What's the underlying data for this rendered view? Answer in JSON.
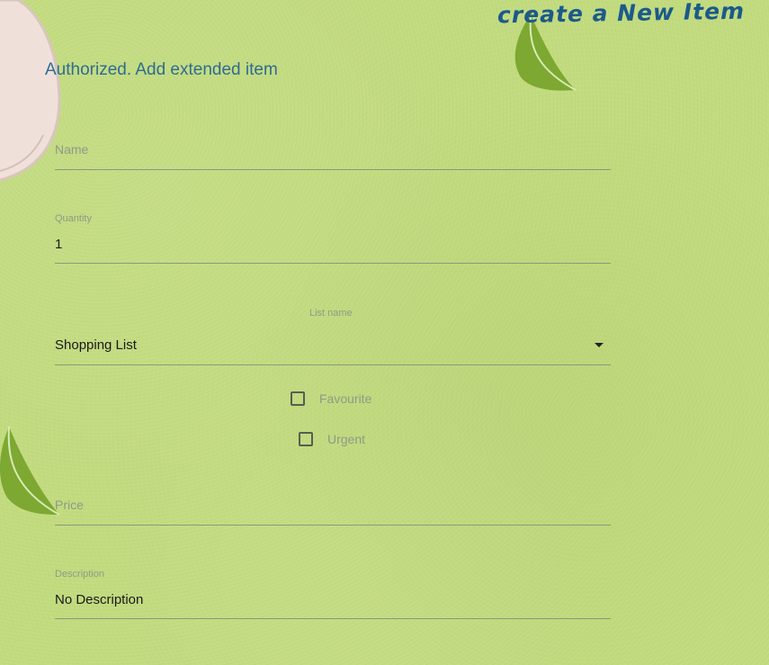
{
  "header": {
    "title": "create a New Item",
    "status": "Authorized. Add extended item"
  },
  "form": {
    "name": {
      "placeholder": "Name",
      "value": ""
    },
    "quantity": {
      "label": "Quantity",
      "value": "1"
    },
    "list": {
      "label": "List name",
      "selected": "Shopping List"
    },
    "favourite": {
      "label": "Favourite",
      "checked": false
    },
    "urgent": {
      "label": "Urgent",
      "checked": false
    },
    "price": {
      "placeholder": "Price",
      "value": ""
    },
    "description": {
      "label": "Description",
      "value": "No Description"
    }
  },
  "icons": {
    "dropdown": "caret-down-icon",
    "decoration_top": "mushroom-decoration",
    "decoration_leaf_top": "leaf-icon",
    "decoration_leaf_left": "leaf-icon"
  },
  "colors": {
    "background": "#c2db7f",
    "title": "#1c5a8a",
    "status": "#2f6c92",
    "underline": "#8a9a7a",
    "muted_text": "#8f9a86"
  }
}
